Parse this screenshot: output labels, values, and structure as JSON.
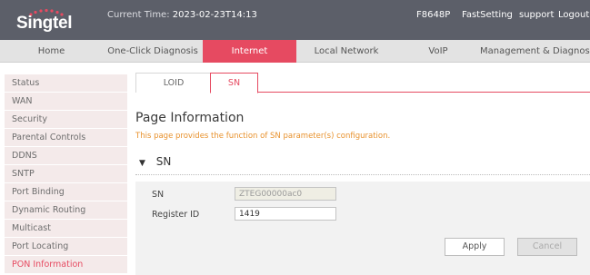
{
  "header": {
    "brand": "Singtel",
    "time_label": "Current Time:",
    "time_value": "2023-02-23T14:13",
    "device": "F8648P",
    "fast_setting": "FastSetting",
    "user": "support",
    "logout": "Logout"
  },
  "main_nav": {
    "tabs": [
      {
        "label": "Home",
        "active": false
      },
      {
        "label": "One-Click Diagnosis",
        "active": false
      },
      {
        "label": "Internet",
        "active": true
      },
      {
        "label": "Local Network",
        "active": false
      },
      {
        "label": "VoIP",
        "active": false
      },
      {
        "label": "Management & Diagnosis",
        "active": false
      }
    ]
  },
  "sidebar": {
    "items": [
      {
        "label": "Status"
      },
      {
        "label": "WAN"
      },
      {
        "label": "Security"
      },
      {
        "label": "Parental Controls"
      },
      {
        "label": "DDNS"
      },
      {
        "label": "SNTP"
      },
      {
        "label": "Port Binding"
      },
      {
        "label": "Dynamic Routing"
      },
      {
        "label": "Multicast"
      },
      {
        "label": "Port Locating"
      },
      {
        "label": "PON Information",
        "active": true
      }
    ]
  },
  "sub_tabs": [
    {
      "label": "LOID",
      "active": false
    },
    {
      "label": "SN",
      "active": true
    }
  ],
  "page": {
    "title": "Page Information",
    "description": "This page provides the function of SN parameter(s) configuration."
  },
  "section": {
    "title": "SN"
  },
  "form": {
    "sn_label": "SN",
    "sn_value": "ZTEG00000ac0",
    "register_label": "Register ID",
    "register_value": "1419"
  },
  "buttons": {
    "apply": "Apply",
    "cancel": "Cancel"
  },
  "colors": {
    "accent": "#e64a61",
    "topbar": "#5c5f69",
    "description": "#e8922e"
  }
}
